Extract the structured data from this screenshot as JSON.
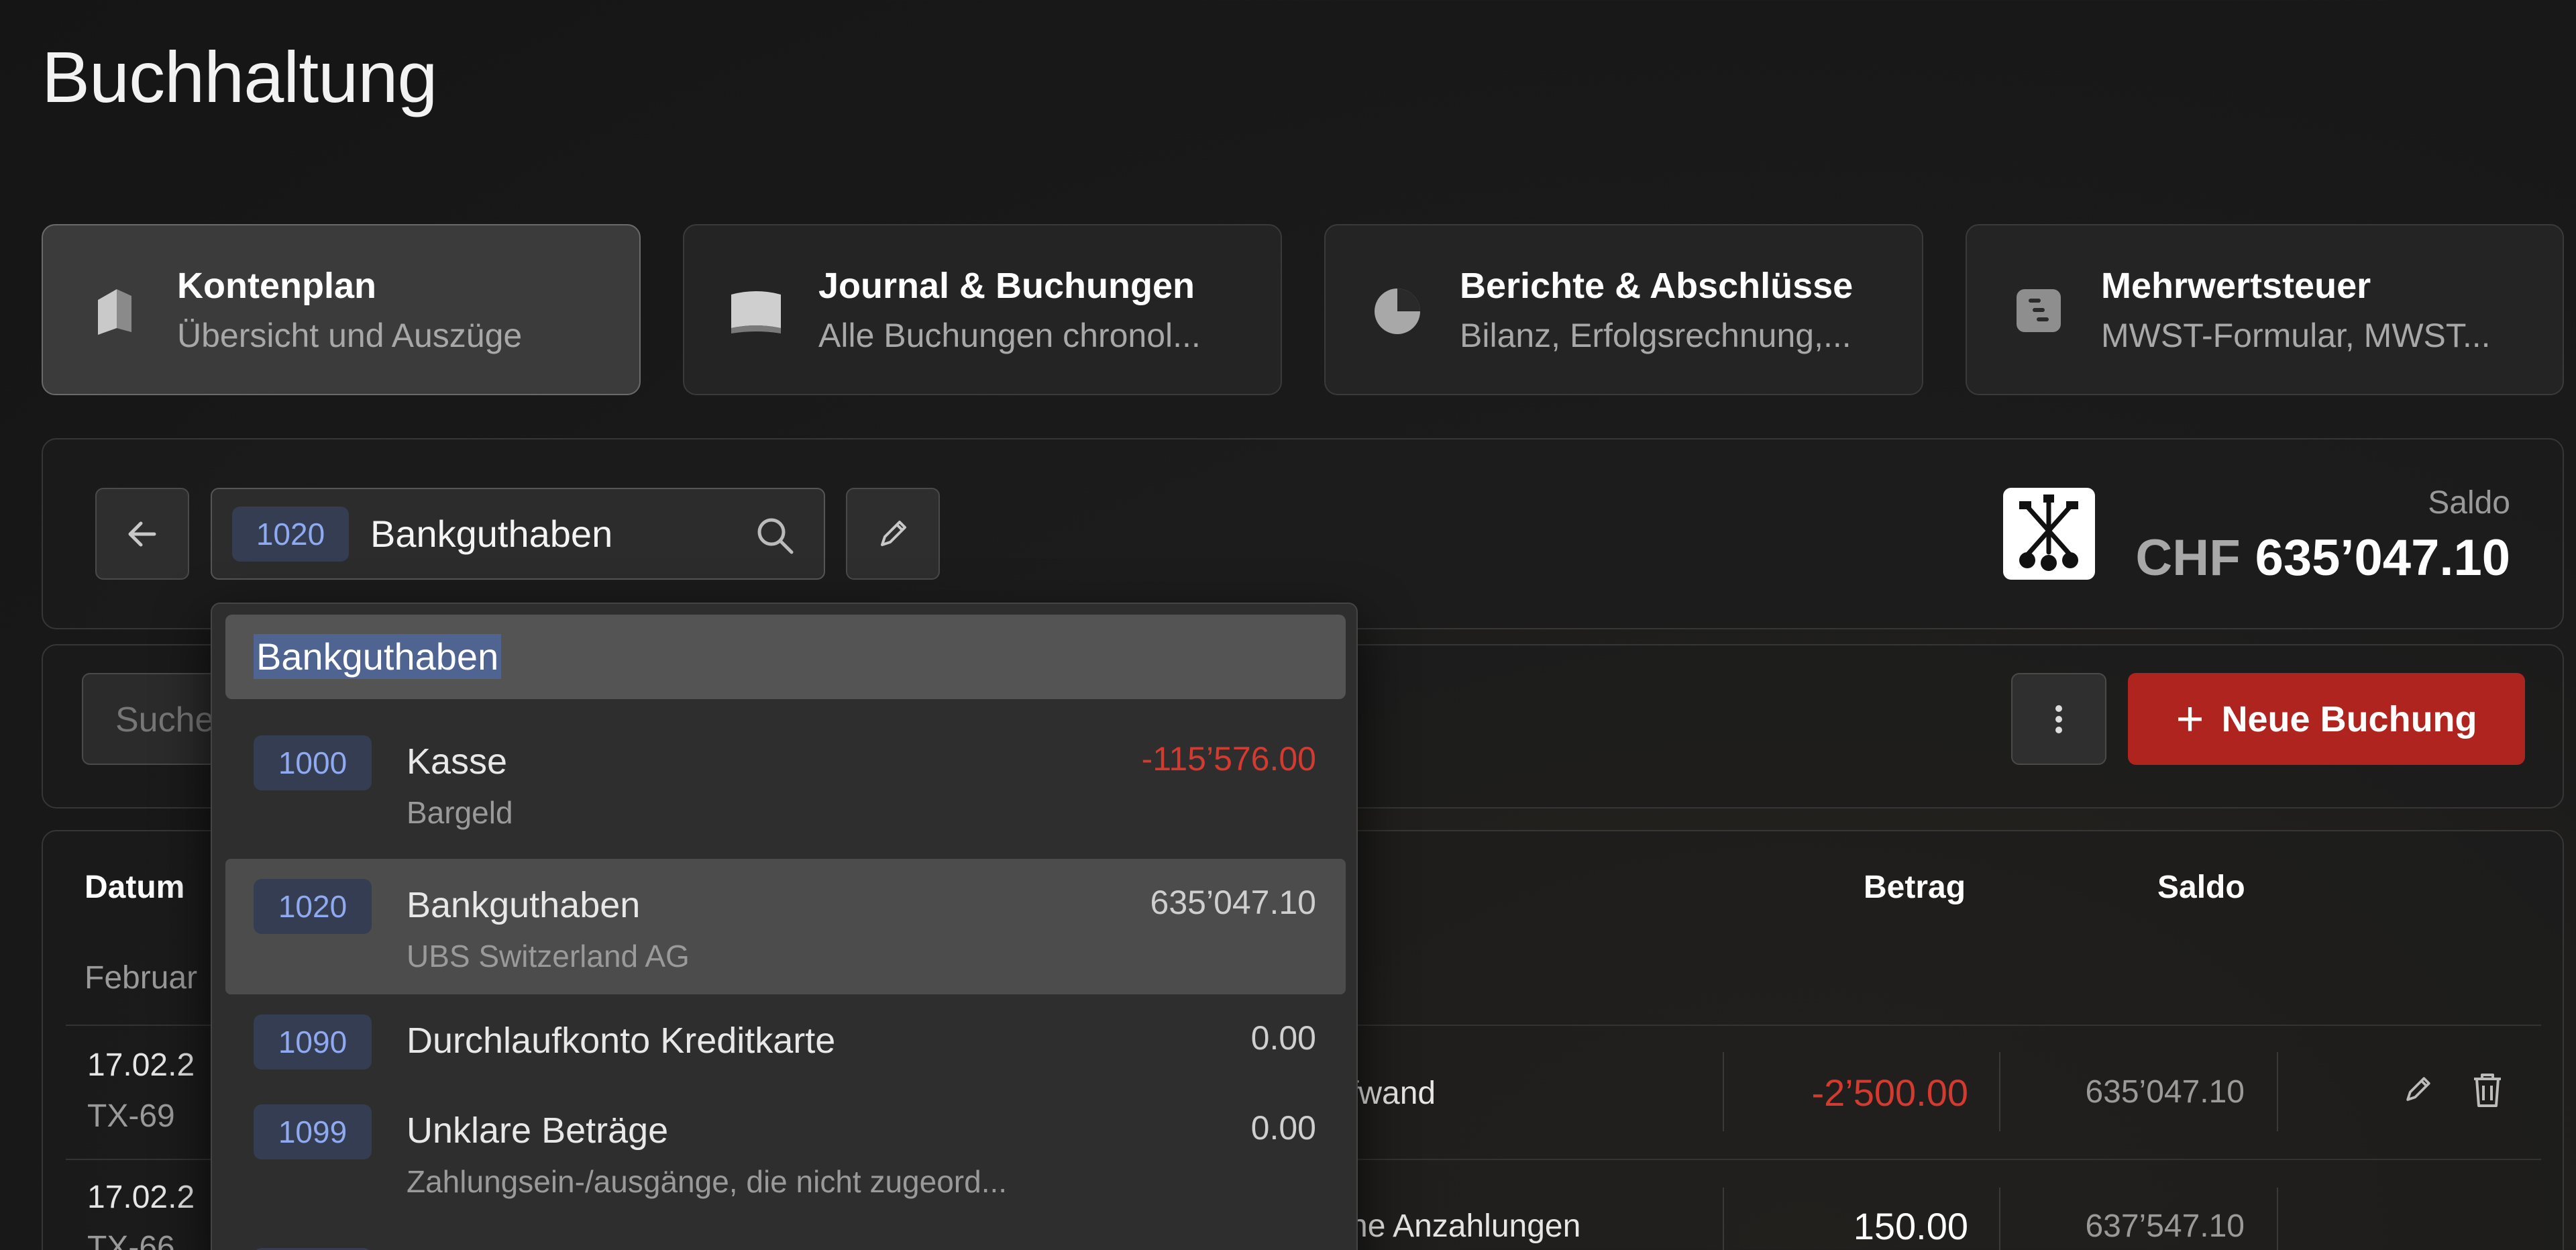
{
  "page": {
    "title": "Buchhaltung"
  },
  "nav_cards": [
    {
      "title": "Kontenplan",
      "subtitle": "Übersicht und Auszüge",
      "icon": "ledger-icon"
    },
    {
      "title": "Journal & Buchungen",
      "subtitle": "Alle Buchungen chronol...",
      "icon": "book-icon"
    },
    {
      "title": "Berichte & Abschlüsse",
      "subtitle": "Bilanz, Erfolgsrechnung,...",
      "icon": "pie-chart-icon"
    },
    {
      "title": "Mehrwertsteuer",
      "subtitle": "MWST-Formular, MWST...",
      "icon": "tax-icon"
    }
  ],
  "account": {
    "code": "1020",
    "name": "Bankguthaben",
    "saldo_label": "Saldo",
    "saldo_currency": "CHF",
    "saldo_value": "635’047.10"
  },
  "toolbar": {
    "search_placeholder": "Suche",
    "new_button_label": "Neue Buchung"
  },
  "table": {
    "headers": {
      "date": "Datum",
      "amount": "Betrag",
      "balance": "Saldo"
    },
    "month_label": "Februar",
    "rows": [
      {
        "date": "17.02.2",
        "ref": "TX-69",
        "desc": "fwand",
        "amount": "-2’500.00",
        "balance": "635’047.10"
      },
      {
        "date": "17.02.2",
        "ref": "TX-66",
        "desc": "ne Anzahlungen",
        "amount": "150.00",
        "balance": "637’547.10"
      }
    ]
  },
  "dropdown": {
    "search_value": "Bankguthaben",
    "items": [
      {
        "code": "1000",
        "name": "Kasse",
        "sub": "Bargeld",
        "amount": "-115’576.00"
      },
      {
        "code": "1020",
        "name": "Bankguthaben",
        "sub": "UBS Switzerland AG",
        "amount": "635’047.10"
      },
      {
        "code": "1090",
        "name": "Durchlaufkonto Kreditkarte",
        "sub": "",
        "amount": "0.00"
      },
      {
        "code": "1099",
        "name": "Unklare Beträge",
        "sub": "Zahlungsein-/ausgänge, die nicht zugeord...",
        "amount": "0.00"
      }
    ]
  },
  "colors": {
    "accent_red": "#b0241f",
    "negative": "#d33a30",
    "badge_bg": "#343d52",
    "badge_text": "#8faaf0"
  }
}
